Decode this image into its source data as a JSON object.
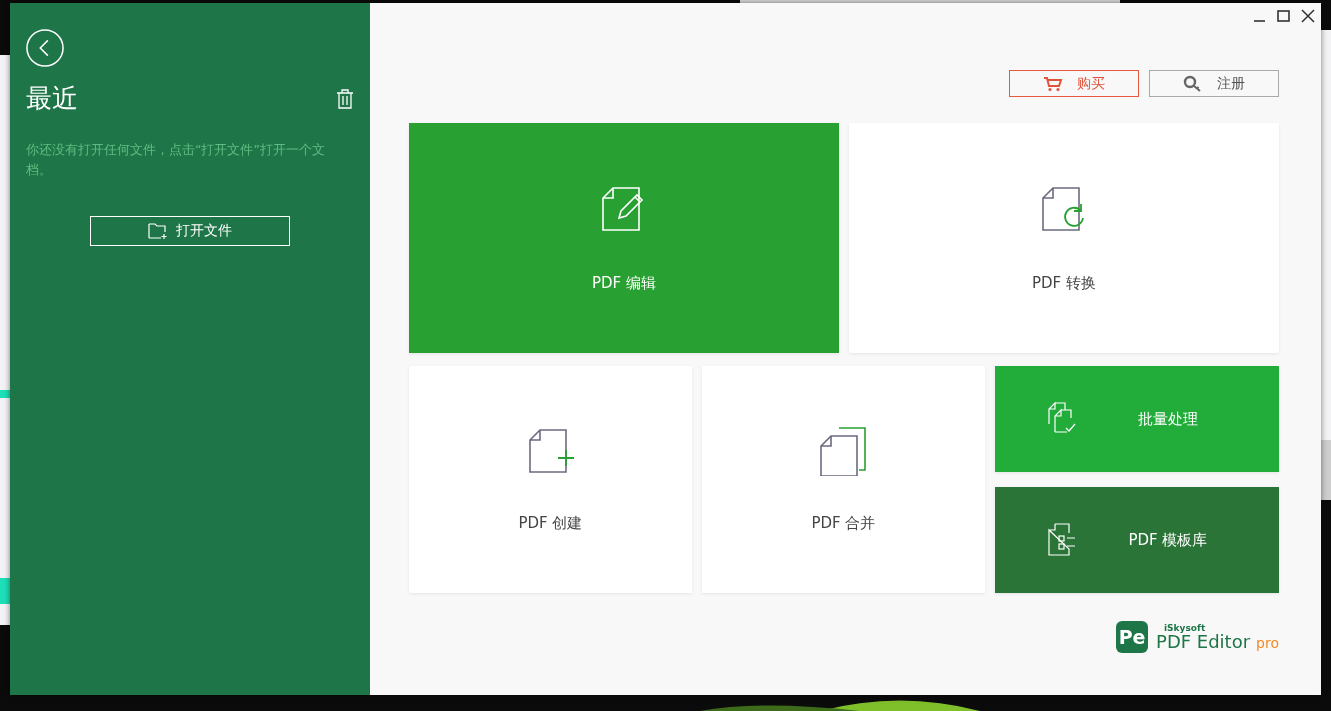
{
  "sidebar": {
    "title": "最近",
    "message": "你还没有打开任何文件，点击“打开文件”打开一个文档。",
    "open_button": "打开文件"
  },
  "header_buttons": [
    {
      "kind": "buy",
      "label": "购买"
    },
    {
      "kind": "register",
      "label": "注册"
    }
  ],
  "tiles": [
    {
      "kind": "edit",
      "label": "PDF 编辑",
      "color": "#28a032"
    },
    {
      "kind": "convert",
      "label": "PDF 转换",
      "color": "#ffffff"
    },
    {
      "kind": "create",
      "label": "PDF 创建",
      "color": "#ffffff"
    },
    {
      "kind": "combine",
      "label": "PDF 合并",
      "color": "#ffffff"
    },
    {
      "kind": "batch",
      "label": "批量处理",
      "color": "#22ad3a"
    },
    {
      "kind": "template",
      "label": "PDF 模板库",
      "color": "#2a7438"
    }
  ],
  "logo": {
    "badge": "Pe",
    "brand": "iSkysoft",
    "product": "PDF Editor",
    "edition": "pro"
  }
}
